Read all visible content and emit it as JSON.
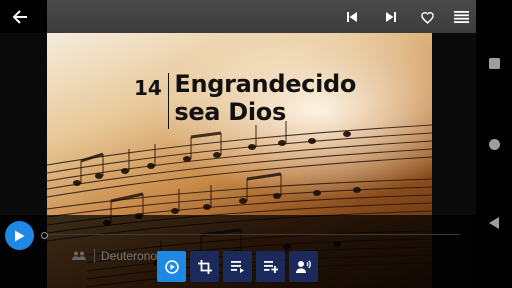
{
  "song": {
    "number": "14",
    "title_line_1": "Engrandecido",
    "title_line_2": "sea Dios"
  },
  "scripture": {
    "text": "Deuterono"
  },
  "colors": {
    "top_bar": "#424242",
    "accent_blue": "#1e88e5",
    "tool_button": "#1b2a5a",
    "nav_bar": "#000000"
  },
  "icons": {
    "top_bar": [
      "back-arrow-icon",
      "skip-previous-icon",
      "skip-next-icon",
      "heart-outline-icon",
      "menu-lines-icon"
    ],
    "player": "play-icon",
    "tools": [
      "play-circle-icon",
      "crop-icon",
      "playlist-icon",
      "playlist-add-icon",
      "record-voice-icon"
    ],
    "android_nav": [
      "recent-apps-square-icon",
      "home-circle-icon",
      "back-triangle-icon"
    ],
    "scripture": "people-icon"
  }
}
